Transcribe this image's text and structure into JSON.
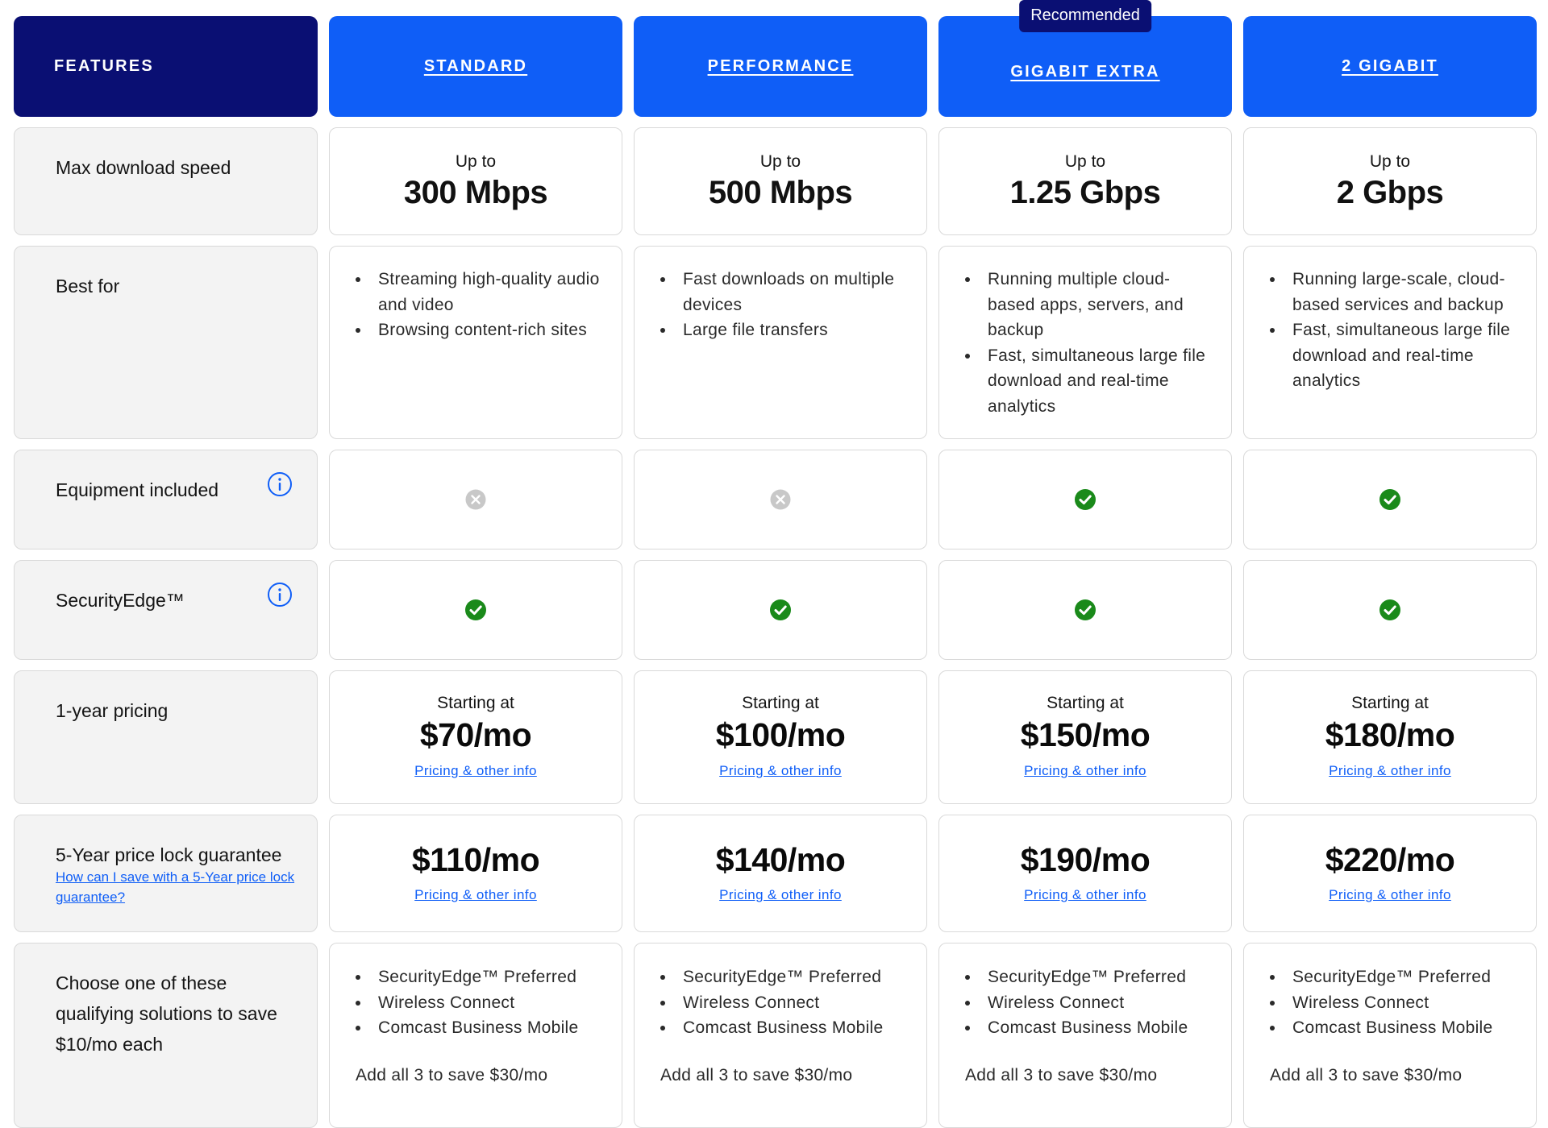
{
  "header": {
    "features_label": "FEATURES",
    "plans": [
      {
        "name": "STANDARD",
        "badge": ""
      },
      {
        "name": "PERFORMANCE",
        "badge": ""
      },
      {
        "name": "GIGABIT EXTRA",
        "badge": "Recommended"
      },
      {
        "name": "2 GIGABIT",
        "badge": ""
      }
    ]
  },
  "features": {
    "max_download_speed": "Max download speed",
    "best_for": "Best for",
    "equipment_included": "Equipment included",
    "security_edge": "SecurityEdge™",
    "one_year_pricing": "1-year pricing",
    "five_year_lock": "5-Year price lock guarantee",
    "five_year_link": "How can I save with a 5-Year price lock guarantee?",
    "qualifying": "Choose one of these qualifying solutions to save $10/mo each"
  },
  "speed": {
    "prefix": "Up to",
    "values": [
      "300 Mbps",
      "500 Mbps",
      "1.25 Gbps",
      "2 Gbps"
    ]
  },
  "best_for": [
    [
      "Streaming high-quality audio and video",
      "Browsing content-rich sites"
    ],
    [
      "Fast downloads on multiple devices",
      "Large file transfers"
    ],
    [
      "Running multiple cloud-based apps, servers, and backup",
      "Fast, simultaneous large file download and real-time analytics"
    ],
    [
      "Running large-scale, cloud-based services and backup",
      "Fast, simultaneous large file download and real-time analytics"
    ]
  ],
  "equipment_included": [
    "no",
    "no",
    "yes",
    "yes"
  ],
  "security_edge": [
    "yes",
    "yes",
    "yes",
    "yes"
  ],
  "pricing": {
    "prefix": "Starting at",
    "link": "Pricing & other info",
    "one_year": [
      "$70/mo",
      "$100/mo",
      "$150/mo",
      "$180/mo"
    ],
    "five_year": [
      "$110/mo",
      "$140/mo",
      "$190/mo",
      "$220/mo"
    ]
  },
  "solutions": {
    "items": [
      "SecurityEdge™ Preferred",
      "Wireless Connect",
      "Comcast Business Mobile"
    ],
    "note": "Add all 3 to save $30/mo"
  },
  "colors": {
    "navy": "#0a0f73",
    "blue": "#0f5ef7",
    "check_green": "#1a8a1a",
    "cross_gray": "#c8c8c8"
  }
}
